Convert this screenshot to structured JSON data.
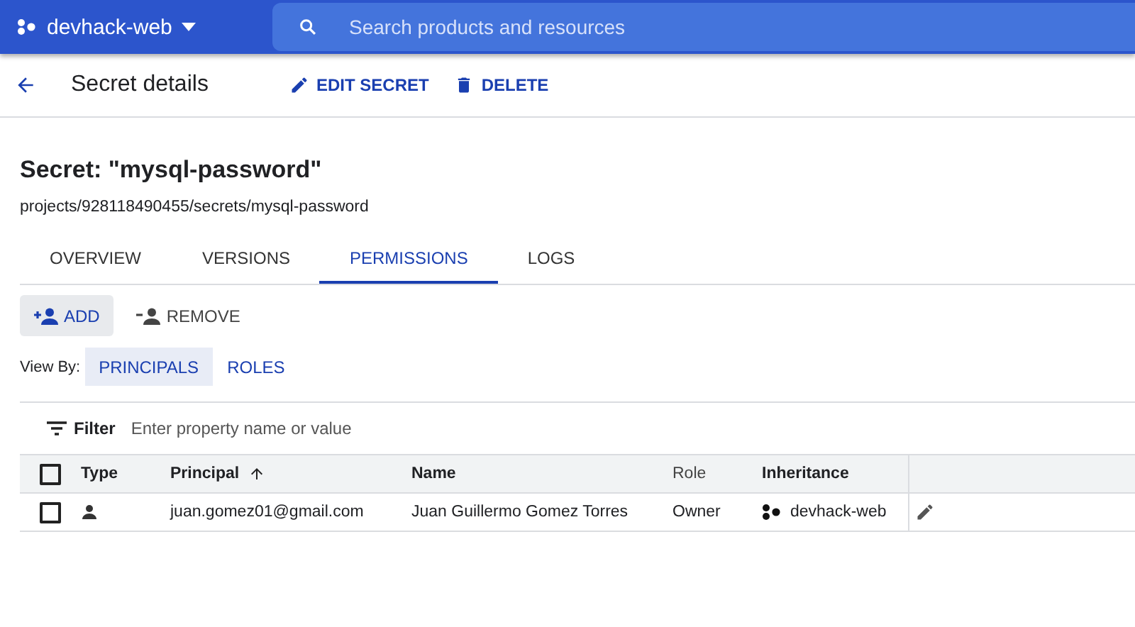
{
  "top_bar": {
    "project": "devhack-web",
    "search": {
      "placeholder": "Search products and resources"
    }
  },
  "header": {
    "title": "Secret details",
    "actions": [
      {
        "label": "EDIT SECRET",
        "kind": "edit"
      },
      {
        "label": "DELETE",
        "kind": "delete"
      }
    ]
  },
  "secret": {
    "title": "Secret: \"mysql-password\"",
    "path": "projects/928118490455/secrets/mysql-password"
  },
  "tabs": [
    {
      "label": "OVERVIEW",
      "selected": false
    },
    {
      "label": "VERSIONS",
      "selected": false
    },
    {
      "label": "PERMISSIONS",
      "selected": true
    },
    {
      "label": "LOGS",
      "selected": false
    }
  ],
  "toolbar": [
    {
      "label": "ADD",
      "kind": "add",
      "selected": true
    },
    {
      "label": "REMOVE",
      "kind": "remove",
      "selected": false
    }
  ],
  "view_by": {
    "label": "View By:",
    "options": [
      {
        "label": "PRINCIPALS",
        "selected": true
      },
      {
        "label": "ROLES",
        "selected": false
      }
    ]
  },
  "filter": {
    "label": "Filter",
    "placeholder": "Enter property name or value"
  },
  "table": {
    "select_all": {
      "checked": false
    },
    "columns": [
      {
        "label": "Type",
        "bold": true
      },
      {
        "label": "Principal",
        "bold": true,
        "sorted": true
      },
      {
        "label": "Name",
        "bold": true
      },
      {
        "label": "Role",
        "bold": false
      },
      {
        "label": "Inheritance",
        "bold": true
      }
    ],
    "rows": [
      {
        "checked": false,
        "principal": "juan.gomez01@gmail.com",
        "name": "Juan Guillermo Gomez Torres",
        "role": "Owner",
        "inheritance": "devhack-web"
      }
    ]
  }
}
